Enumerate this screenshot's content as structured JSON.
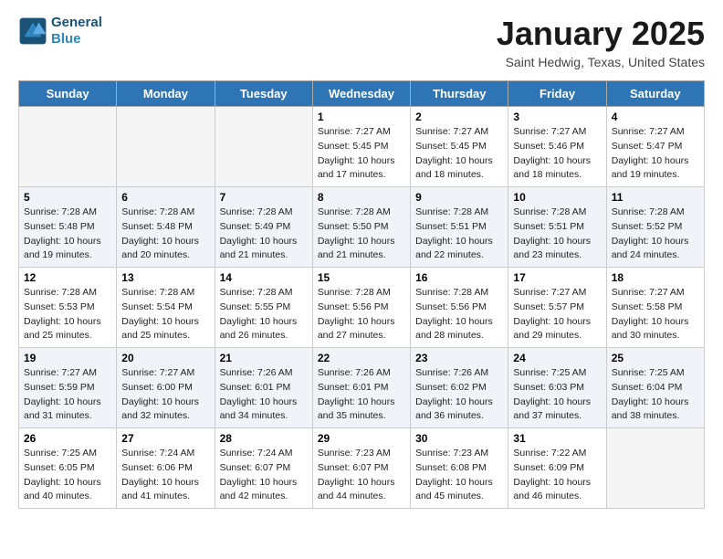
{
  "header": {
    "logo_line1": "General",
    "logo_line2": "Blue",
    "title": "January 2025",
    "location": "Saint Hedwig, Texas, United States"
  },
  "days_of_week": [
    "Sunday",
    "Monday",
    "Tuesday",
    "Wednesday",
    "Thursday",
    "Friday",
    "Saturday"
  ],
  "weeks": [
    [
      {
        "day": "",
        "empty": true
      },
      {
        "day": "",
        "empty": true
      },
      {
        "day": "",
        "empty": true
      },
      {
        "day": "1",
        "sunrise": "7:27 AM",
        "sunset": "5:45 PM",
        "daylight": "10 hours and 17 minutes."
      },
      {
        "day": "2",
        "sunrise": "7:27 AM",
        "sunset": "5:45 PM",
        "daylight": "10 hours and 18 minutes."
      },
      {
        "day": "3",
        "sunrise": "7:27 AM",
        "sunset": "5:46 PM",
        "daylight": "10 hours and 18 minutes."
      },
      {
        "day": "4",
        "sunrise": "7:27 AM",
        "sunset": "5:47 PM",
        "daylight": "10 hours and 19 minutes."
      }
    ],
    [
      {
        "day": "5",
        "sunrise": "7:28 AM",
        "sunset": "5:48 PM",
        "daylight": "10 hours and 19 minutes."
      },
      {
        "day": "6",
        "sunrise": "7:28 AM",
        "sunset": "5:48 PM",
        "daylight": "10 hours and 20 minutes."
      },
      {
        "day": "7",
        "sunrise": "7:28 AM",
        "sunset": "5:49 PM",
        "daylight": "10 hours and 21 minutes."
      },
      {
        "day": "8",
        "sunrise": "7:28 AM",
        "sunset": "5:50 PM",
        "daylight": "10 hours and 21 minutes."
      },
      {
        "day": "9",
        "sunrise": "7:28 AM",
        "sunset": "5:51 PM",
        "daylight": "10 hours and 22 minutes."
      },
      {
        "day": "10",
        "sunrise": "7:28 AM",
        "sunset": "5:51 PM",
        "daylight": "10 hours and 23 minutes."
      },
      {
        "day": "11",
        "sunrise": "7:28 AM",
        "sunset": "5:52 PM",
        "daylight": "10 hours and 24 minutes."
      }
    ],
    [
      {
        "day": "12",
        "sunrise": "7:28 AM",
        "sunset": "5:53 PM",
        "daylight": "10 hours and 25 minutes."
      },
      {
        "day": "13",
        "sunrise": "7:28 AM",
        "sunset": "5:54 PM",
        "daylight": "10 hours and 25 minutes."
      },
      {
        "day": "14",
        "sunrise": "7:28 AM",
        "sunset": "5:55 PM",
        "daylight": "10 hours and 26 minutes."
      },
      {
        "day": "15",
        "sunrise": "7:28 AM",
        "sunset": "5:56 PM",
        "daylight": "10 hours and 27 minutes."
      },
      {
        "day": "16",
        "sunrise": "7:28 AM",
        "sunset": "5:56 PM",
        "daylight": "10 hours and 28 minutes."
      },
      {
        "day": "17",
        "sunrise": "7:27 AM",
        "sunset": "5:57 PM",
        "daylight": "10 hours and 29 minutes."
      },
      {
        "day": "18",
        "sunrise": "7:27 AM",
        "sunset": "5:58 PM",
        "daylight": "10 hours and 30 minutes."
      }
    ],
    [
      {
        "day": "19",
        "sunrise": "7:27 AM",
        "sunset": "5:59 PM",
        "daylight": "10 hours and 31 minutes."
      },
      {
        "day": "20",
        "sunrise": "7:27 AM",
        "sunset": "6:00 PM",
        "daylight": "10 hours and 32 minutes."
      },
      {
        "day": "21",
        "sunrise": "7:26 AM",
        "sunset": "6:01 PM",
        "daylight": "10 hours and 34 minutes."
      },
      {
        "day": "22",
        "sunrise": "7:26 AM",
        "sunset": "6:01 PM",
        "daylight": "10 hours and 35 minutes."
      },
      {
        "day": "23",
        "sunrise": "7:26 AM",
        "sunset": "6:02 PM",
        "daylight": "10 hours and 36 minutes."
      },
      {
        "day": "24",
        "sunrise": "7:25 AM",
        "sunset": "6:03 PM",
        "daylight": "10 hours and 37 minutes."
      },
      {
        "day": "25",
        "sunrise": "7:25 AM",
        "sunset": "6:04 PM",
        "daylight": "10 hours and 38 minutes."
      }
    ],
    [
      {
        "day": "26",
        "sunrise": "7:25 AM",
        "sunset": "6:05 PM",
        "daylight": "10 hours and 40 minutes."
      },
      {
        "day": "27",
        "sunrise": "7:24 AM",
        "sunset": "6:06 PM",
        "daylight": "10 hours and 41 minutes."
      },
      {
        "day": "28",
        "sunrise": "7:24 AM",
        "sunset": "6:07 PM",
        "daylight": "10 hours and 42 minutes."
      },
      {
        "day": "29",
        "sunrise": "7:23 AM",
        "sunset": "6:07 PM",
        "daylight": "10 hours and 44 minutes."
      },
      {
        "day": "30",
        "sunrise": "7:23 AM",
        "sunset": "6:08 PM",
        "daylight": "10 hours and 45 minutes."
      },
      {
        "day": "31",
        "sunrise": "7:22 AM",
        "sunset": "6:09 PM",
        "daylight": "10 hours and 46 minutes."
      },
      {
        "day": "",
        "empty": true
      }
    ]
  ]
}
